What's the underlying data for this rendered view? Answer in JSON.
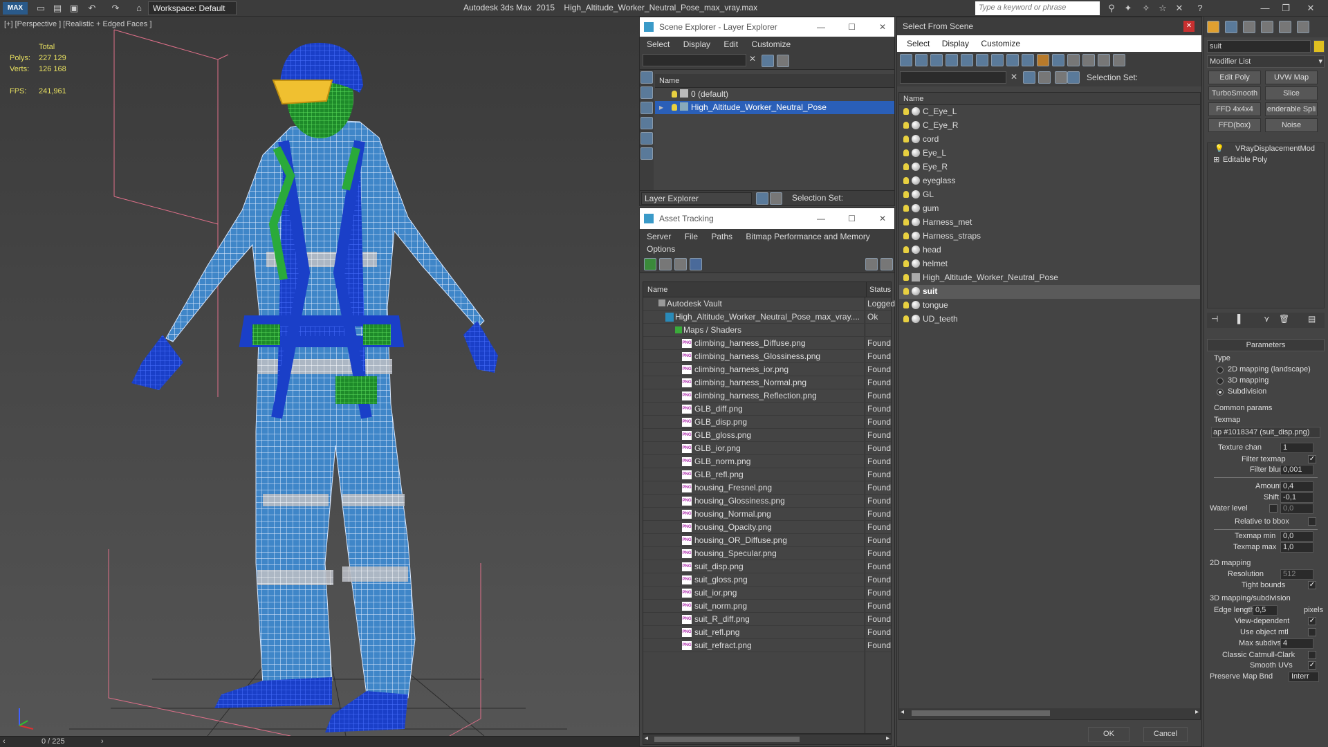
{
  "app": {
    "title": "Autodesk 3ds Max  2015    High_Altitude_Worker_Neutral_Pose_max_vray.max",
    "workspace": "Workspace: Default",
    "search_placeholder": "Type a keyword or phrase"
  },
  "viewport": {
    "label": "[+] [Perspective ] [Realistic + Edged Faces ]",
    "stats": {
      "total_label": "Total",
      "polys_label": "Polys:",
      "polys": "227 129",
      "verts_label": "Verts:",
      "verts": "126 168",
      "fps_label": "FPS:",
      "fps": "241,961"
    },
    "timeline": "0 / 225"
  },
  "scene_explorer": {
    "title": "Scene Explorer - Layer Explorer",
    "menu": [
      "Select",
      "Display",
      "Edit",
      "Customize"
    ],
    "column": "Name",
    "rows": [
      "0 (default)",
      "High_Altitude_Worker_Neutral_Pose"
    ],
    "footer_mode": "Layer Explorer",
    "footer_selection": "Selection Set:"
  },
  "asset_tracking": {
    "title": "Asset Tracking",
    "menu": [
      "Server",
      "File",
      "Paths",
      "Bitmap Performance and Memory"
    ],
    "menu2": "Options",
    "col_name": "Name",
    "col_status": "Status",
    "vault": {
      "name": "Autodesk Vault",
      "status": "Logged"
    },
    "file": {
      "name": "High_Altitude_Worker_Neutral_Pose_max_vray....",
      "status": "Ok"
    },
    "maps_folder": "Maps / Shaders",
    "maps": [
      {
        "name": "climbing_harness_Diffuse.png",
        "status": "Found"
      },
      {
        "name": "climbing_harness_Glossiness.png",
        "status": "Found"
      },
      {
        "name": "climbing_harness_ior.png",
        "status": "Found"
      },
      {
        "name": "climbing_harness_Normal.png",
        "status": "Found"
      },
      {
        "name": "climbing_harness_Reflection.png",
        "status": "Found"
      },
      {
        "name": "GLB_diff.png",
        "status": "Found"
      },
      {
        "name": "GLB_disp.png",
        "status": "Found"
      },
      {
        "name": "GLB_gloss.png",
        "status": "Found"
      },
      {
        "name": "GLB_ior.png",
        "status": "Found"
      },
      {
        "name": "GLB_norm.png",
        "status": "Found"
      },
      {
        "name": "GLB_refl.png",
        "status": "Found"
      },
      {
        "name": "housing_Fresnel.png",
        "status": "Found"
      },
      {
        "name": "housing_Glossiness.png",
        "status": "Found"
      },
      {
        "name": "housing_Normal.png",
        "status": "Found"
      },
      {
        "name": "housing_Opacity.png",
        "status": "Found"
      },
      {
        "name": "housing_OR_Diffuse.png",
        "status": "Found"
      },
      {
        "name": "housing_Specular.png",
        "status": "Found"
      },
      {
        "name": "suit_disp.png",
        "status": "Found"
      },
      {
        "name": "suit_gloss.png",
        "status": "Found"
      },
      {
        "name": "suit_ior.png",
        "status": "Found"
      },
      {
        "name": "suit_norm.png",
        "status": "Found"
      },
      {
        "name": "suit_R_diff.png",
        "status": "Found"
      },
      {
        "name": "suit_refl.png",
        "status": "Found"
      },
      {
        "name": "suit_refract.png",
        "status": "Found"
      }
    ],
    "png_badge": "PNG"
  },
  "select_from_scene": {
    "title": "Select From Scene",
    "menu": [
      "Select",
      "Display",
      "Customize"
    ],
    "selection_set": "Selection Set:",
    "column": "Name",
    "items": [
      "C_Eye_L",
      "C_Eye_R",
      "cord",
      "Eye_L",
      "Eye_R",
      "eyeglass",
      "GL",
      "gum",
      "Harness_met",
      "Harness_straps",
      "head",
      "helmet",
      "High_Altitude_Worker_Neutral_Pose",
      "suit",
      "tongue",
      "UD_teeth"
    ],
    "selected": "suit",
    "ok": "OK",
    "cancel": "Cancel"
  },
  "command_panel": {
    "object_name": "suit",
    "modifier_list": "Modifier List",
    "buttons": [
      "Edit Poly",
      "UVW Map",
      "TurboSmooth",
      "Slice",
      "FFD 4x4x4",
      "enderable Spli",
      "FFD(box)",
      "Noise"
    ],
    "stack": [
      "VRayDisplacementMod",
      "Editable Poly"
    ],
    "params_title": "Parameters",
    "type_label": "Type",
    "types": [
      "2D mapping (landscape)",
      "3D mapping",
      "Subdivision"
    ],
    "common_params": "Common params",
    "texmap_label": "Texmap",
    "texmap_value": "ap #1018347 (suit_disp.png)",
    "texture_chan_label": "Texture chan",
    "texture_chan": "1",
    "filter_texmap_label": "Filter texmap",
    "filter_blur_label": "Filter blur",
    "filter_blur": "0,001",
    "amount_label": "Amount",
    "amount": "0,4",
    "shift_label": "Shift",
    "shift": "-0,1",
    "water_level_label": "Water level",
    "water_level": "0,0",
    "relative_bbox_label": "Relative to bbox",
    "texmap_min_label": "Texmap min",
    "texmap_min": "0,0",
    "texmap_max_label": "Texmap max",
    "texmap_max": "1,0",
    "mapping_2d": "2D mapping",
    "resolution_label": "Resolution",
    "resolution": "512",
    "tight_bounds_label": "Tight bounds",
    "mapping_3d": "3D mapping/subdivision",
    "edge_length_label": "Edge length",
    "edge_length": "0,5",
    "pixels_label": "pixels",
    "view_dependent_label": "View-dependent",
    "use_object_mtl_label": "Use object mtl",
    "max_subdivs_label": "Max subdivs",
    "max_subdivs": "4",
    "catmull_label": "Classic Catmull-Clark",
    "smooth_uvs_label": "Smooth UVs",
    "preserve_label": "Preserve Map Bnd",
    "preserve_value": "Interr"
  }
}
